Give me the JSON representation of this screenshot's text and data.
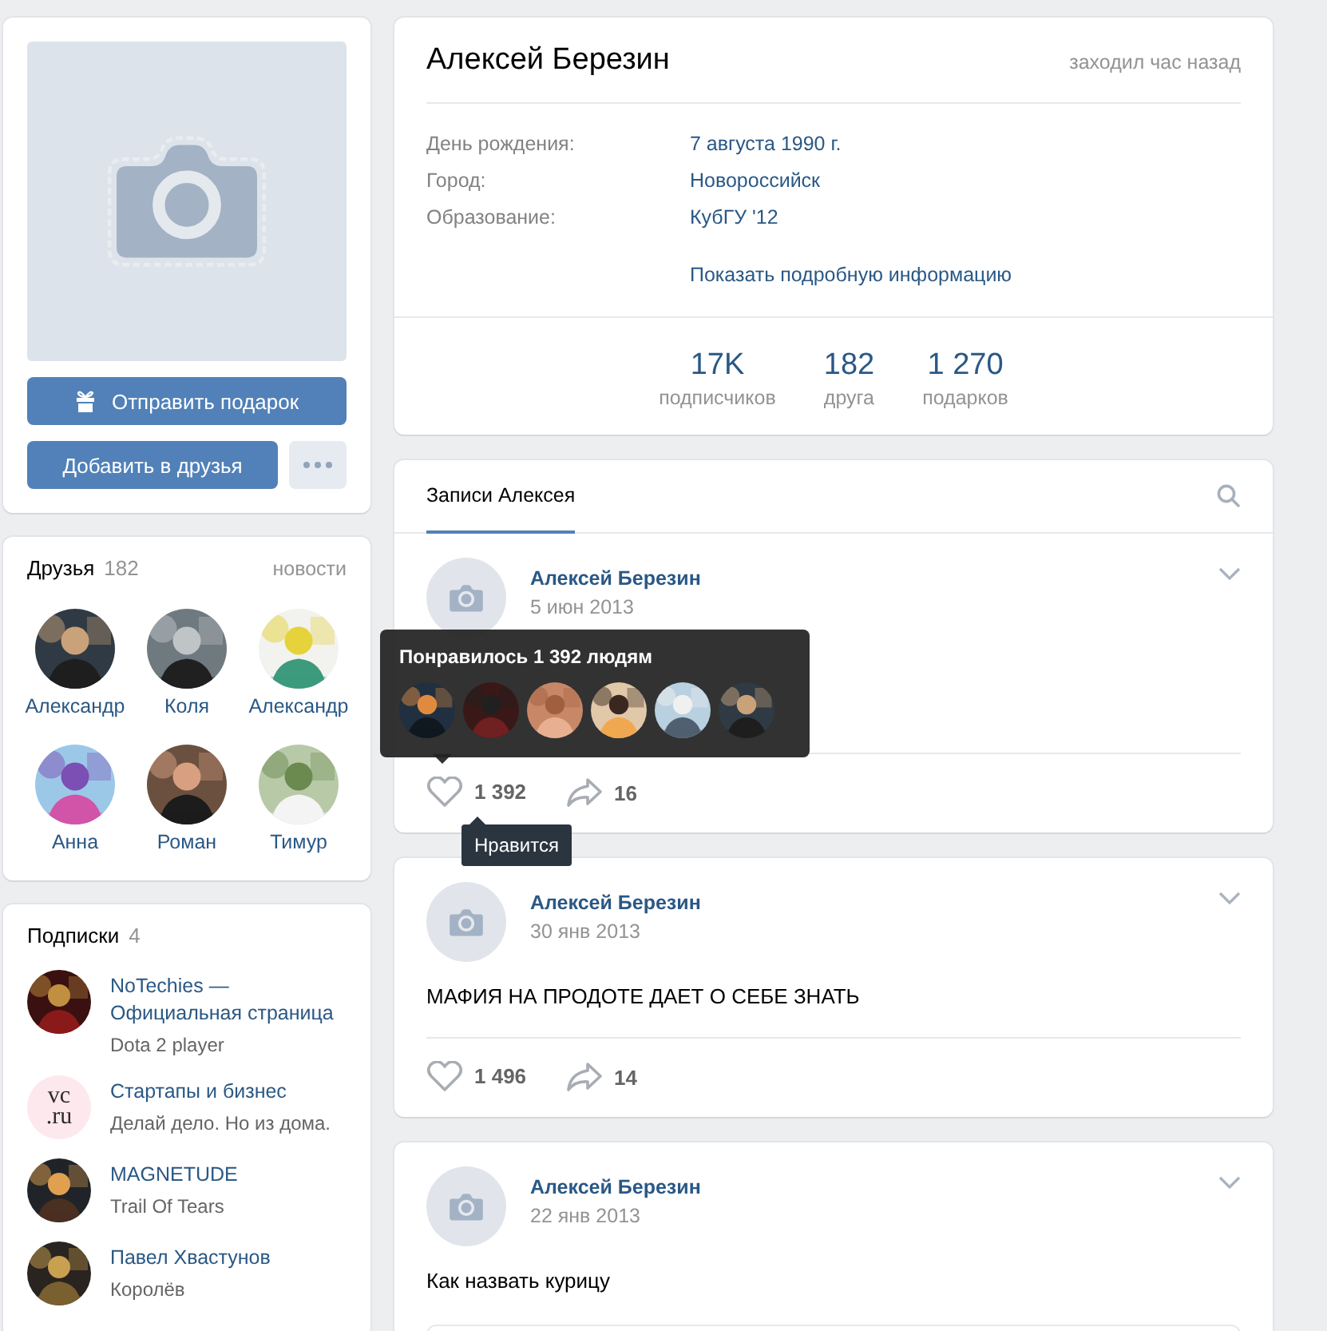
{
  "profile_actions": {
    "gift_button": "Отправить подарок",
    "add_button": "Добавить в друзья"
  },
  "friends": {
    "title": "Друзья",
    "count": "182",
    "link": "новости",
    "items": [
      {
        "name": "Александр"
      },
      {
        "name": "Коля"
      },
      {
        "name": "Александр"
      },
      {
        "name": "Анна"
      },
      {
        "name": "Роман"
      },
      {
        "name": "Тимур"
      }
    ]
  },
  "subscriptions": {
    "title": "Подписки",
    "count": "4",
    "items": [
      {
        "name": "NoTechies — Официальная страница",
        "subtitle": "Dota 2 player"
      },
      {
        "name": "Стартапы и бизнес",
        "subtitle": "Делай дело. Но из дома.",
        "avatar": {
          "kind": "logo",
          "lines": [
            "vc",
            ".ru"
          ]
        }
      },
      {
        "name": "MAGNETUDE",
        "subtitle": "Trail Of Tears"
      },
      {
        "name": "Павел Хвастунов",
        "subtitle": "Королёв"
      }
    ]
  },
  "profile": {
    "name": "Алексей Березин",
    "last_seen": "заходил час назад",
    "info": [
      {
        "label": "День рождения:",
        "value": "7 августа 1990 г."
      },
      {
        "label": "Город:",
        "value": "Новороссийск"
      },
      {
        "label": "Образование:",
        "value": "КубГУ '12"
      }
    ],
    "more_link": "Показать подробную информацию",
    "counters": [
      {
        "value": "17K",
        "label": "подписчиков"
      },
      {
        "value": "182",
        "label": "друга"
      },
      {
        "value": "1 270",
        "label": "подарков"
      }
    ]
  },
  "wall": {
    "tabs": [
      {
        "label": "Записи Алексея",
        "selected": true
      }
    ]
  },
  "posts": [
    {
      "author": "Алексей Березин",
      "date": "5 июн 2013",
      "likes": "1 392",
      "shares": "16",
      "attachment": false
    },
    {
      "author": "Алексей Березин",
      "date": "30 янв 2013",
      "text": "МАФИЯ НА ПРОДОТЕ ДАЕТ О СЕБЕ ЗНАТЬ",
      "likes": "1 496",
      "shares": "14",
      "attachment": false
    },
    {
      "author": "Алексей Березин",
      "date": "22 янв 2013",
      "text": "Как назвать курицу",
      "attachment": true
    }
  ],
  "likes_tooltip": {
    "title": "Понравилось 1 392 людям"
  },
  "hint_tooltip": {
    "text": "Нравится"
  }
}
